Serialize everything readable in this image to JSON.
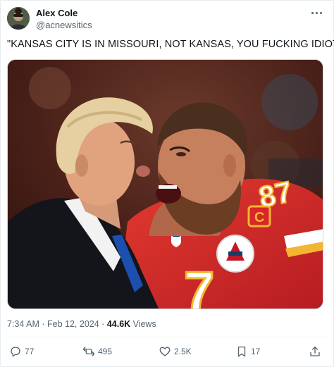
{
  "tweet": {
    "author_name": "Alex Cole",
    "author_handle": "@acnewsitics",
    "text": "\"KANSAS CITY IS IN MISSOURI, NOT KANSAS, YOU FUCKING IDIOT!\"",
    "time": "7:34 AM",
    "date": "Feb 12, 2024",
    "separator": "·",
    "views_count": "44.6K",
    "views_label": "Views"
  },
  "media": {
    "jersey_numbers": "87",
    "jersey_front_number": "7",
    "captain_letter": "C"
  },
  "actions": {
    "replies": "77",
    "reposts": "495",
    "likes": "2.5K",
    "bookmarks": "17"
  },
  "icons": {
    "more": "more-horizontal-icon",
    "reply": "reply-icon",
    "repost": "repost-icon",
    "like": "heart-icon",
    "bookmark": "bookmark-icon",
    "share": "share-icon"
  },
  "colors": {
    "text_primary": "#0f1419",
    "text_secondary": "#536471",
    "jersey_red": "#d8262a",
    "jersey_gold": "#f2b632"
  }
}
